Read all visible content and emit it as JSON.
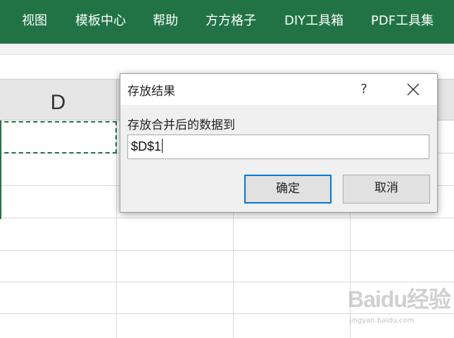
{
  "ribbon": {
    "tabs": [
      {
        "label": "视图"
      },
      {
        "label": "模板中心"
      },
      {
        "label": "帮助"
      },
      {
        "label": "方方格子"
      },
      {
        "label": "DIY工具箱"
      },
      {
        "label": "PDF工具集"
      }
    ]
  },
  "sheet": {
    "column_header": "D"
  },
  "dialog": {
    "title": "存放结果",
    "help_label": "?",
    "prompt": "存放合并后的数据到",
    "input_value": "$D$1",
    "ok_label": "确定",
    "cancel_label": "取消"
  },
  "watermark": {
    "logo": "Baidu经验",
    "url": "jingyan.baidu.com"
  },
  "colors": {
    "ribbon": "#217346",
    "selection": "#217346",
    "focus_border": "#0078d7"
  }
}
